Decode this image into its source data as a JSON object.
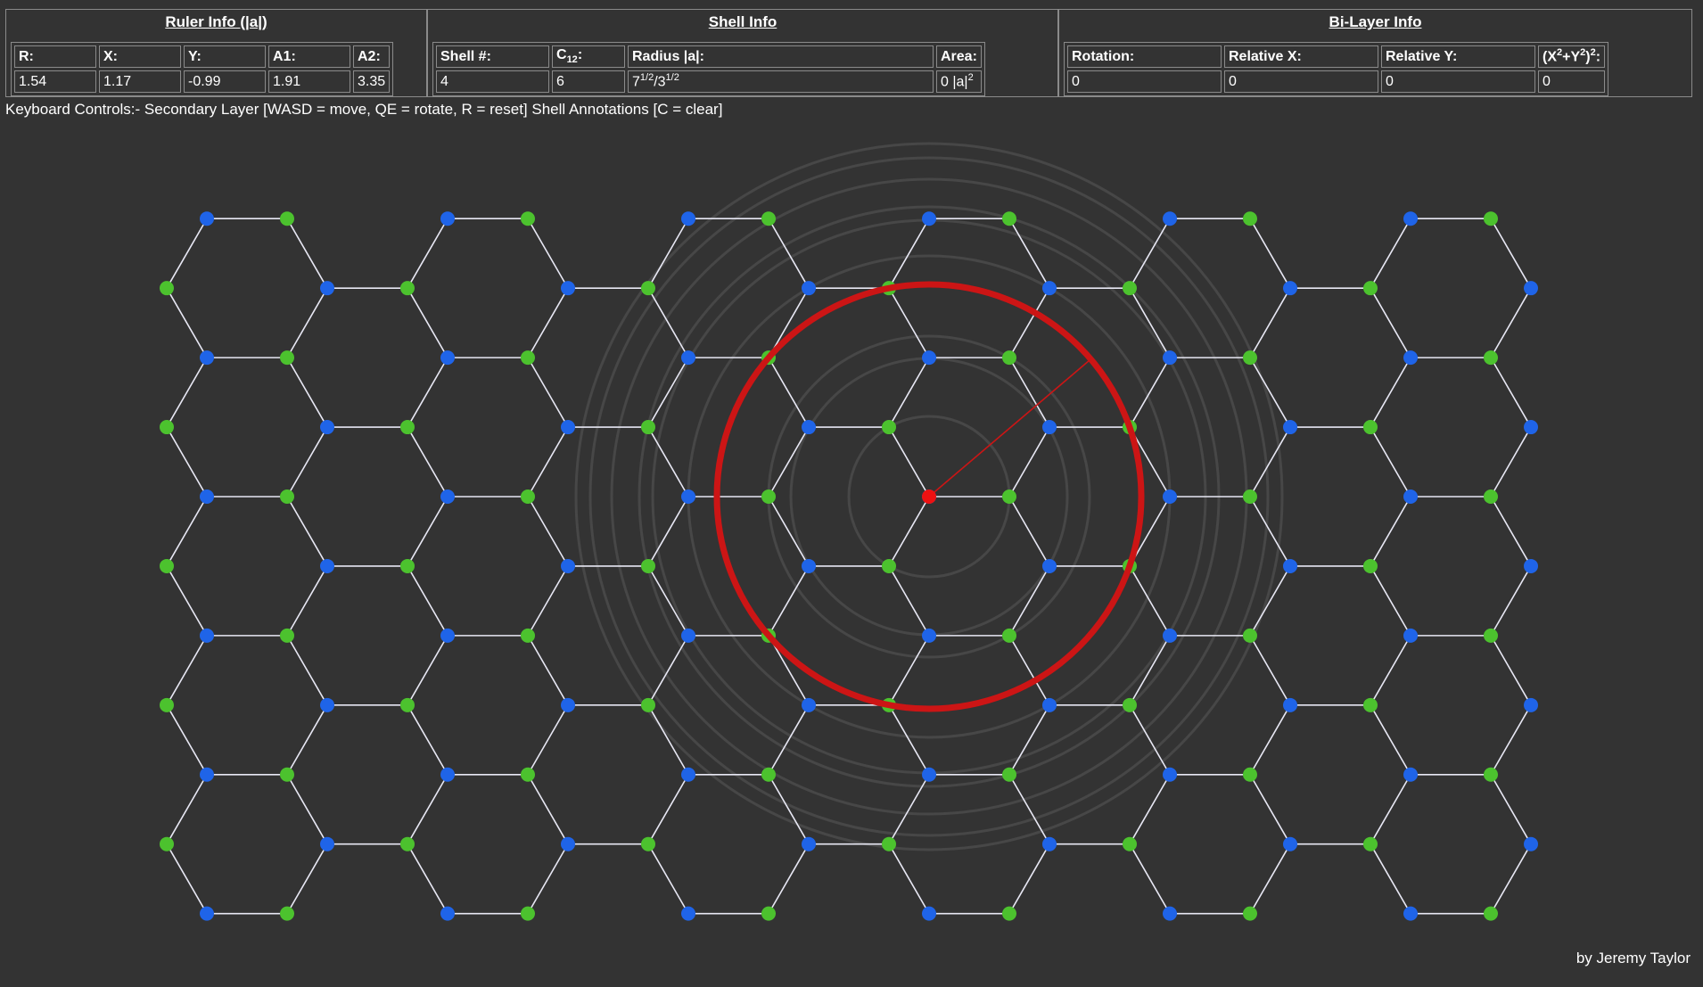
{
  "ruler": {
    "title": "Ruler Info (|a|)",
    "headers": [
      "R:",
      "X:",
      "Y:",
      "A1:",
      "A2:"
    ],
    "values": [
      "1.54",
      "1.17",
      "-0.99",
      "1.91",
      "3.35"
    ]
  },
  "shell": {
    "title": "Shell Info",
    "headers": {
      "shell": "Shell #:",
      "c_base": "C",
      "c_sub": "12",
      "c_tail": ":",
      "radius": "Radius |a|:",
      "area": "Area:"
    },
    "values": {
      "shell": "4",
      "c12": "6",
      "radius_base1": "7",
      "radius_exp1": "1/2",
      "radius_mid": "/3",
      "radius_exp2": "1/2",
      "area_base": "0 |a|",
      "area_exp": "2"
    }
  },
  "bilayer": {
    "title": "Bi-Layer Info",
    "headers": {
      "rotation": "Rotation:",
      "relx": "Relative X:",
      "rely": "Relative Y:",
      "d_open": "(X",
      "d_exp1": "2",
      "d_mid": "+Y",
      "d_exp2": "2",
      "d_close": ")",
      "d_exp3": "2",
      "d_tail": ":"
    },
    "values": [
      "0",
      "0",
      "0",
      "0"
    ]
  },
  "keyboard_text": "Keyboard Controls:- Secondary Layer [WASD = move, QE = rotate, R = reset] Shell Annotations [C = clear]",
  "credit": "by Jeremy Taylor",
  "lattice": {
    "colors": {
      "sublattice_a": "#1f64e8",
      "sublattice_b": "#4cc22e",
      "bond": "#e8e8f4",
      "shell_circle": "#cc1515",
      "guide_circles": "#474747",
      "origin": "#ee1111"
    }
  }
}
